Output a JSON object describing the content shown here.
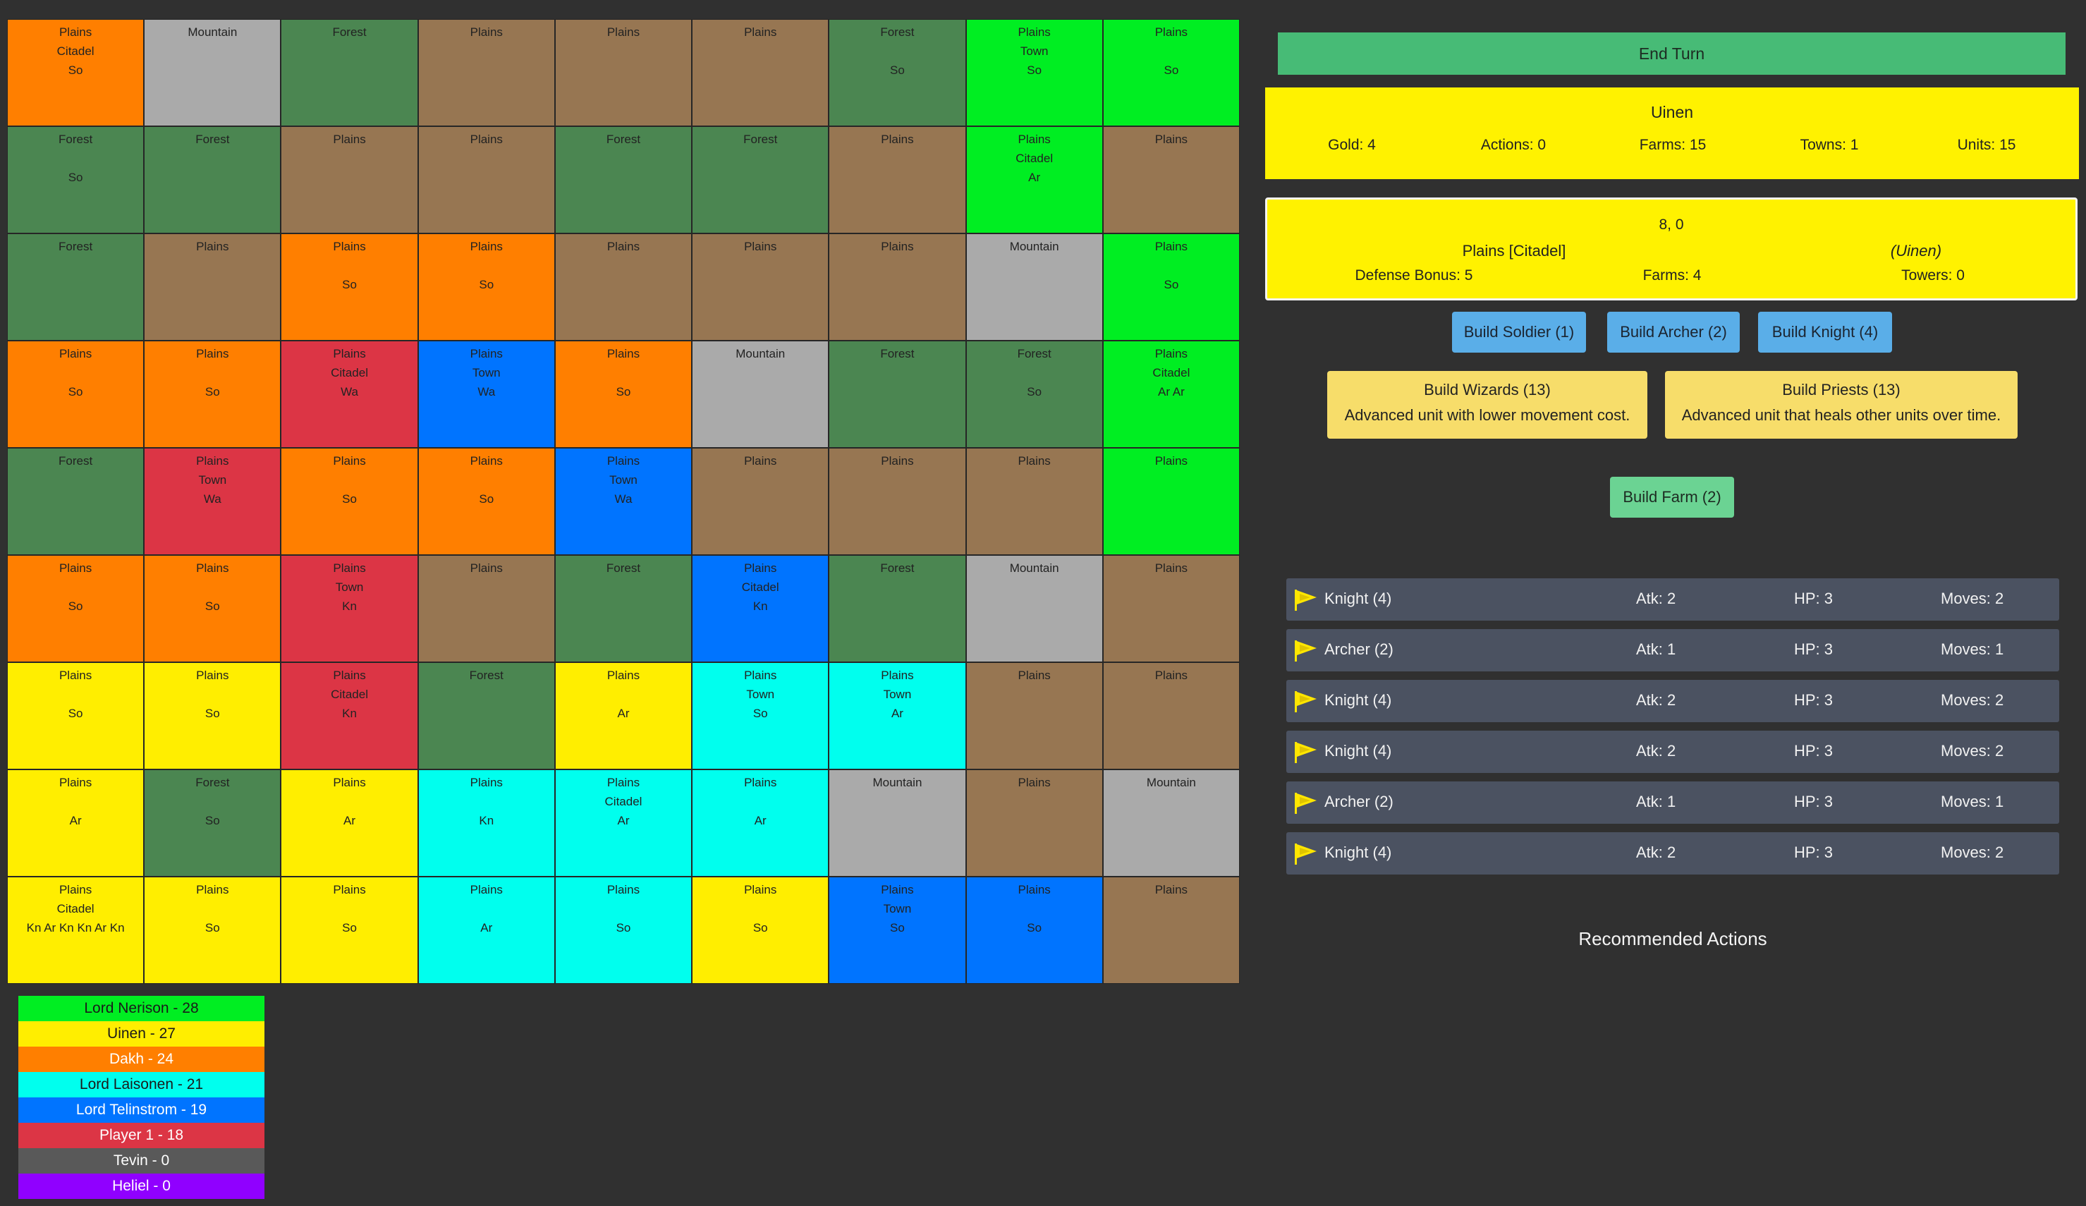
{
  "map": {
    "rows": [
      [
        {
          "terrain": "Plains",
          "feature": "Citadel",
          "units": "So",
          "owner": "dakh"
        },
        {
          "terrain": "Mountain",
          "feature": "",
          "units": "",
          "owner": ""
        },
        {
          "terrain": "Forest",
          "feature": "",
          "units": "",
          "owner": ""
        },
        {
          "terrain": "Plains",
          "feature": "",
          "units": "",
          "owner": ""
        },
        {
          "terrain": "Plains",
          "feature": "",
          "units": "",
          "owner": ""
        },
        {
          "terrain": "Plains",
          "feature": "",
          "units": "",
          "owner": ""
        },
        {
          "terrain": "Forest",
          "feature": "",
          "units": "So",
          "owner": ""
        },
        {
          "terrain": "Plains",
          "feature": "Town",
          "units": "So",
          "owner": "nerison"
        },
        {
          "terrain": "Plains",
          "feature": "",
          "units": "So",
          "owner": "nerison"
        }
      ],
      [
        {
          "terrain": "Forest",
          "feature": "",
          "units": "So",
          "owner": ""
        },
        {
          "terrain": "Forest",
          "feature": "",
          "units": "",
          "owner": ""
        },
        {
          "terrain": "Plains",
          "feature": "",
          "units": "",
          "owner": ""
        },
        {
          "terrain": "Plains",
          "feature": "",
          "units": "",
          "owner": ""
        },
        {
          "terrain": "Forest",
          "feature": "",
          "units": "",
          "owner": ""
        },
        {
          "terrain": "Forest",
          "feature": "",
          "units": "",
          "owner": ""
        },
        {
          "terrain": "Plains",
          "feature": "",
          "units": "",
          "owner": ""
        },
        {
          "terrain": "Plains",
          "feature": "Citadel",
          "units": "Ar",
          "owner": "nerison"
        },
        {
          "terrain": "Plains",
          "feature": "",
          "units": "",
          "owner": ""
        }
      ],
      [
        {
          "terrain": "Forest",
          "feature": "",
          "units": "",
          "owner": ""
        },
        {
          "terrain": "Plains",
          "feature": "",
          "units": "",
          "owner": ""
        },
        {
          "terrain": "Plains",
          "feature": "",
          "units": "So",
          "owner": "dakh"
        },
        {
          "terrain": "Plains",
          "feature": "",
          "units": "So",
          "owner": "dakh"
        },
        {
          "terrain": "Plains",
          "feature": "",
          "units": "",
          "owner": ""
        },
        {
          "terrain": "Plains",
          "feature": "",
          "units": "",
          "owner": ""
        },
        {
          "terrain": "Plains",
          "feature": "",
          "units": "",
          "owner": ""
        },
        {
          "terrain": "Mountain",
          "feature": "",
          "units": "",
          "owner": ""
        },
        {
          "terrain": "Plains",
          "feature": "",
          "units": "So",
          "owner": "nerison"
        }
      ],
      [
        {
          "terrain": "Plains",
          "feature": "",
          "units": "So",
          "owner": "dakh"
        },
        {
          "terrain": "Plains",
          "feature": "",
          "units": "So",
          "owner": "dakh"
        },
        {
          "terrain": "Plains",
          "feature": "Citadel",
          "units": "Wa",
          "owner": "player1"
        },
        {
          "terrain": "Plains",
          "feature": "Town",
          "units": "Wa",
          "owner": "telinstrom"
        },
        {
          "terrain": "Plains",
          "feature": "",
          "units": "So",
          "owner": "dakh"
        },
        {
          "terrain": "Mountain",
          "feature": "",
          "units": "",
          "owner": ""
        },
        {
          "terrain": "Forest",
          "feature": "",
          "units": "",
          "owner": ""
        },
        {
          "terrain": "Forest",
          "feature": "",
          "units": "So",
          "owner": ""
        },
        {
          "terrain": "Plains",
          "feature": "Citadel",
          "units": "Ar Ar",
          "owner": "nerison"
        }
      ],
      [
        {
          "terrain": "Forest",
          "feature": "",
          "units": "",
          "owner": ""
        },
        {
          "terrain": "Plains",
          "feature": "Town",
          "units": "Wa",
          "owner": "player1"
        },
        {
          "terrain": "Plains",
          "feature": "",
          "units": "So",
          "owner": "dakh"
        },
        {
          "terrain": "Plains",
          "feature": "",
          "units": "So",
          "owner": "dakh"
        },
        {
          "terrain": "Plains",
          "feature": "Town",
          "units": "Wa",
          "owner": "telinstrom"
        },
        {
          "terrain": "Plains",
          "feature": "",
          "units": "",
          "owner": ""
        },
        {
          "terrain": "Plains",
          "feature": "",
          "units": "",
          "owner": ""
        },
        {
          "terrain": "Plains",
          "feature": "",
          "units": "",
          "owner": ""
        },
        {
          "terrain": "Plains",
          "feature": "",
          "units": "",
          "owner": "nerison"
        }
      ],
      [
        {
          "terrain": "Plains",
          "feature": "",
          "units": "So",
          "owner": "dakh"
        },
        {
          "terrain": "Plains",
          "feature": "",
          "units": "So",
          "owner": "dakh"
        },
        {
          "terrain": "Plains",
          "feature": "Town",
          "units": "Kn",
          "owner": "player1"
        },
        {
          "terrain": "Plains",
          "feature": "",
          "units": "",
          "owner": ""
        },
        {
          "terrain": "Forest",
          "feature": "",
          "units": "",
          "owner": ""
        },
        {
          "terrain": "Plains",
          "feature": "Citadel",
          "units": "Kn",
          "owner": "telinstrom"
        },
        {
          "terrain": "Forest",
          "feature": "",
          "units": "",
          "owner": ""
        },
        {
          "terrain": "Mountain",
          "feature": "",
          "units": "",
          "owner": ""
        },
        {
          "terrain": "Plains",
          "feature": "",
          "units": "",
          "owner": ""
        }
      ],
      [
        {
          "terrain": "Plains",
          "feature": "",
          "units": "So",
          "owner": "uinen"
        },
        {
          "terrain": "Plains",
          "feature": "",
          "units": "So",
          "owner": "uinen"
        },
        {
          "terrain": "Plains",
          "feature": "Citadel",
          "units": "Kn",
          "owner": "player1"
        },
        {
          "terrain": "Forest",
          "feature": "",
          "units": "",
          "owner": ""
        },
        {
          "terrain": "Plains",
          "feature": "",
          "units": "Ar",
          "owner": "uinen"
        },
        {
          "terrain": "Plains",
          "feature": "Town",
          "units": "So",
          "owner": "laisonen"
        },
        {
          "terrain": "Plains",
          "feature": "Town",
          "units": "Ar",
          "owner": "laisonen"
        },
        {
          "terrain": "Plains",
          "feature": "",
          "units": "",
          "owner": ""
        },
        {
          "terrain": "Plains",
          "feature": "",
          "units": "",
          "owner": ""
        }
      ],
      [
        {
          "terrain": "Plains",
          "feature": "",
          "units": "Ar",
          "owner": "uinen"
        },
        {
          "terrain": "Forest",
          "feature": "",
          "units": "So",
          "owner": ""
        },
        {
          "terrain": "Plains",
          "feature": "",
          "units": "Ar",
          "owner": "uinen"
        },
        {
          "terrain": "Plains",
          "feature": "",
          "units": "Kn",
          "owner": "laisonen"
        },
        {
          "terrain": "Plains",
          "feature": "Citadel",
          "units": "Ar",
          "owner": "laisonen"
        },
        {
          "terrain": "Plains",
          "feature": "",
          "units": "Ar",
          "owner": "laisonen"
        },
        {
          "terrain": "Mountain",
          "feature": "",
          "units": "",
          "owner": ""
        },
        {
          "terrain": "Plains",
          "feature": "",
          "units": "",
          "owner": ""
        },
        {
          "terrain": "Mountain",
          "feature": "",
          "units": "",
          "owner": ""
        }
      ],
      [
        {
          "terrain": "Plains",
          "feature": "Citadel",
          "units": "Kn Ar Kn Kn Ar Kn",
          "owner": "uinen"
        },
        {
          "terrain": "Plains",
          "feature": "",
          "units": "So",
          "owner": "uinen"
        },
        {
          "terrain": "Plains",
          "feature": "",
          "units": "So",
          "owner": "uinen"
        },
        {
          "terrain": "Plains",
          "feature": "",
          "units": "Ar",
          "owner": "laisonen"
        },
        {
          "terrain": "Plains",
          "feature": "",
          "units": "So",
          "owner": "laisonen"
        },
        {
          "terrain": "Plains",
          "feature": "",
          "units": "So",
          "owner": "uinen"
        },
        {
          "terrain": "Plains",
          "feature": "Town",
          "units": "So",
          "owner": "telinstrom"
        },
        {
          "terrain": "Plains",
          "feature": "",
          "units": "So",
          "owner": "telinstrom"
        },
        {
          "terrain": "Plains",
          "feature": "",
          "units": "",
          "owner": ""
        }
      ]
    ]
  },
  "legend": [
    {
      "label": "Lord Nerison - 28",
      "color": "#00ee22",
      "text_color": "#1a1a1a"
    },
    {
      "label": "Uinen - 27",
      "color": "#ffee00",
      "text_color": "#1a1a1a"
    },
    {
      "label": "Dakh - 24",
      "color": "#ff7f00",
      "text_color": "#ffffff"
    },
    {
      "label": "Lord Laisonen - 21",
      "color": "#00ffee",
      "text_color": "#1a1a1a"
    },
    {
      "label": "Lord Telinstrom - 19",
      "color": "#0074ff",
      "text_color": "#ffffff"
    },
    {
      "label": "Player 1 - 18",
      "color": "#dc3545",
      "text_color": "#ffffff"
    },
    {
      "label": "Tevin - 0",
      "color": "#595959",
      "text_color": "#ffffff"
    },
    {
      "label": "Heliel - 0",
      "color": "#9000ff",
      "text_color": "#ffffff"
    }
  ],
  "end_turn_label": "End Turn",
  "player": {
    "name": "Uinen",
    "gold": "Gold: 4",
    "actions": "Actions: 0",
    "farms": "Farms: 15",
    "towns": "Towns: 1",
    "units": "Units: 15"
  },
  "tile": {
    "coords": "8, 0",
    "type": "Plains [Citadel]",
    "owner": "(Uinen)",
    "defense": "Defense Bonus: 5",
    "farms": "Farms: 4",
    "towers": "Towers: 0"
  },
  "build": {
    "soldier": "Build Soldier (1)",
    "archer": "Build Archer (2)",
    "knight": "Build Knight (4)",
    "wizards_title": "Build Wizards (13)",
    "wizards_desc": "Advanced unit with lower movement cost.",
    "priests_title": "Build Priests (13)",
    "priests_desc": "Advanced unit that heals other units over time.",
    "farm": "Build Farm (2)"
  },
  "units": [
    {
      "name": "Knight (4)",
      "atk": "Atk: 2",
      "hp": "HP: 3",
      "moves": "Moves: 2"
    },
    {
      "name": "Archer (2)",
      "atk": "Atk: 1",
      "hp": "HP: 3",
      "moves": "Moves: 1"
    },
    {
      "name": "Knight (4)",
      "atk": "Atk: 2",
      "hp": "HP: 3",
      "moves": "Moves: 2"
    },
    {
      "name": "Knight (4)",
      "atk": "Atk: 2",
      "hp": "HP: 3",
      "moves": "Moves: 2"
    },
    {
      "name": "Archer (2)",
      "atk": "Atk: 1",
      "hp": "HP: 3",
      "moves": "Moves: 1"
    },
    {
      "name": "Knight (4)",
      "atk": "Atk: 2",
      "hp": "HP: 3",
      "moves": "Moves: 2"
    }
  ],
  "recommended_title": "Recommended Actions",
  "colors": {
    "background": "#303030",
    "plains": "#977652",
    "forest": "#4b8651",
    "mountain": "#aaaaaa",
    "accent_green": "#47bb76",
    "panel_yellow": "#fff200",
    "button_blue": "#5aaee8",
    "unit_row": "#4b5261"
  }
}
